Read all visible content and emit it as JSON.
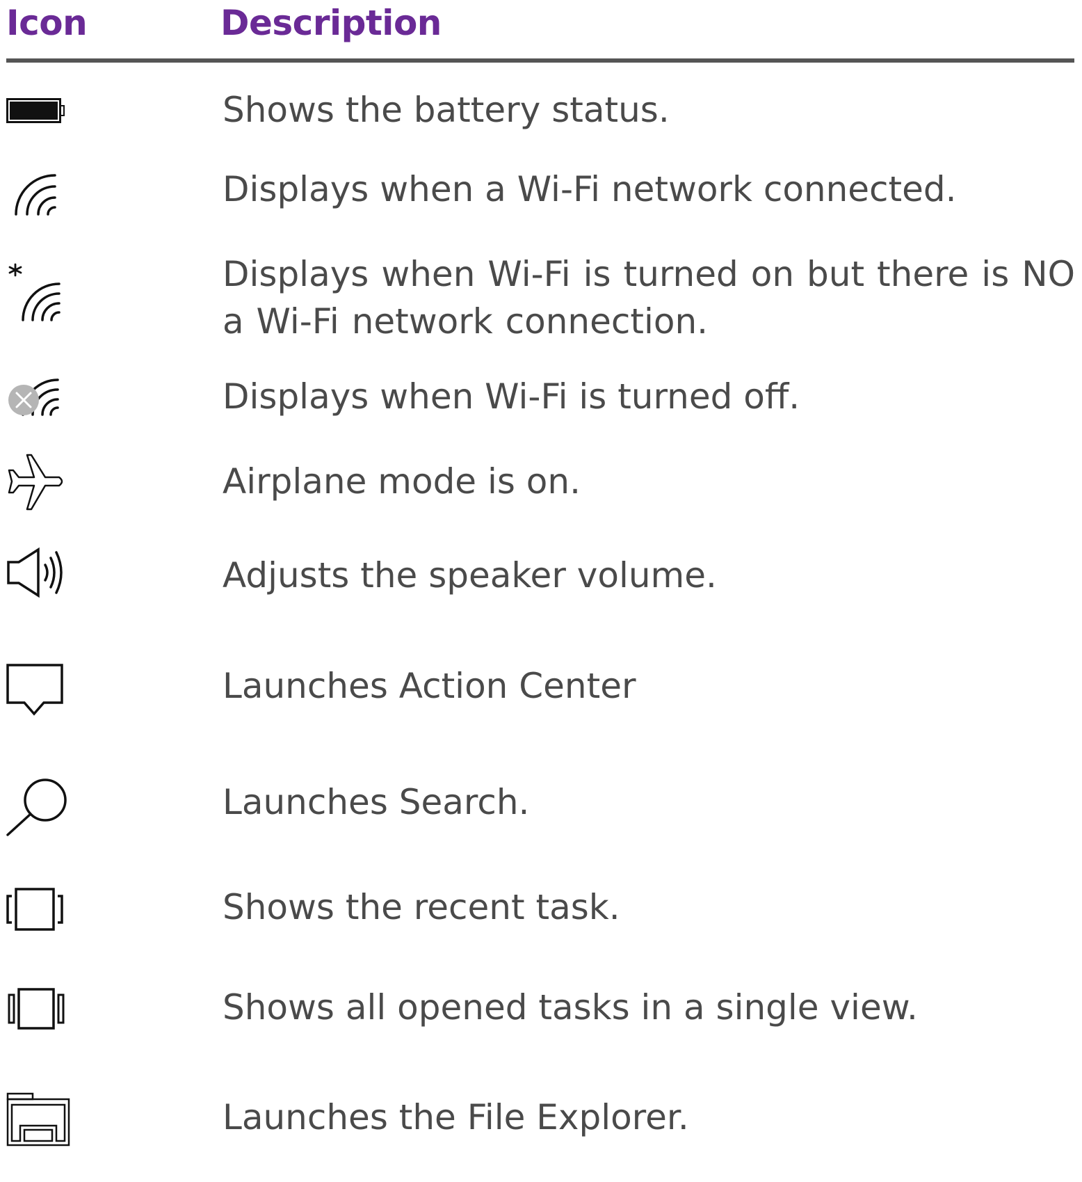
{
  "header": {
    "icon_label": "Icon",
    "description_label": "Description"
  },
  "colors": {
    "header_text": "#6a2a96",
    "body_text": "#4a4a4a",
    "rule": "#555555",
    "icon_stroke": "#111111",
    "wifi_off_badge": "#b5b5b5"
  },
  "rows": [
    {
      "icon": "battery-icon",
      "description": "Shows the battery status."
    },
    {
      "icon": "wifi-connected-icon",
      "description": "Displays when a Wi-Fi network connected."
    },
    {
      "icon": "wifi-no-connection-icon",
      "description": "Displays when Wi-Fi is turned on but there is NO a Wi-Fi network connection."
    },
    {
      "icon": "wifi-off-icon",
      "description": "Displays when Wi-Fi is turned off."
    },
    {
      "icon": "airplane-icon",
      "description": "Airplane mode is on."
    },
    {
      "icon": "speaker-icon",
      "description": "Adjusts the speaker volume."
    },
    {
      "icon": "action-center-icon",
      "description": "Launches Action Center"
    },
    {
      "icon": "search-icon",
      "description": "Launches Search."
    },
    {
      "icon": "recent-task-icon",
      "description": "Shows the recent task."
    },
    {
      "icon": "task-view-icon",
      "description": "Shows all opened tasks in a single view."
    },
    {
      "icon": "file-explorer-icon",
      "description": "Launches the File Explorer."
    }
  ]
}
